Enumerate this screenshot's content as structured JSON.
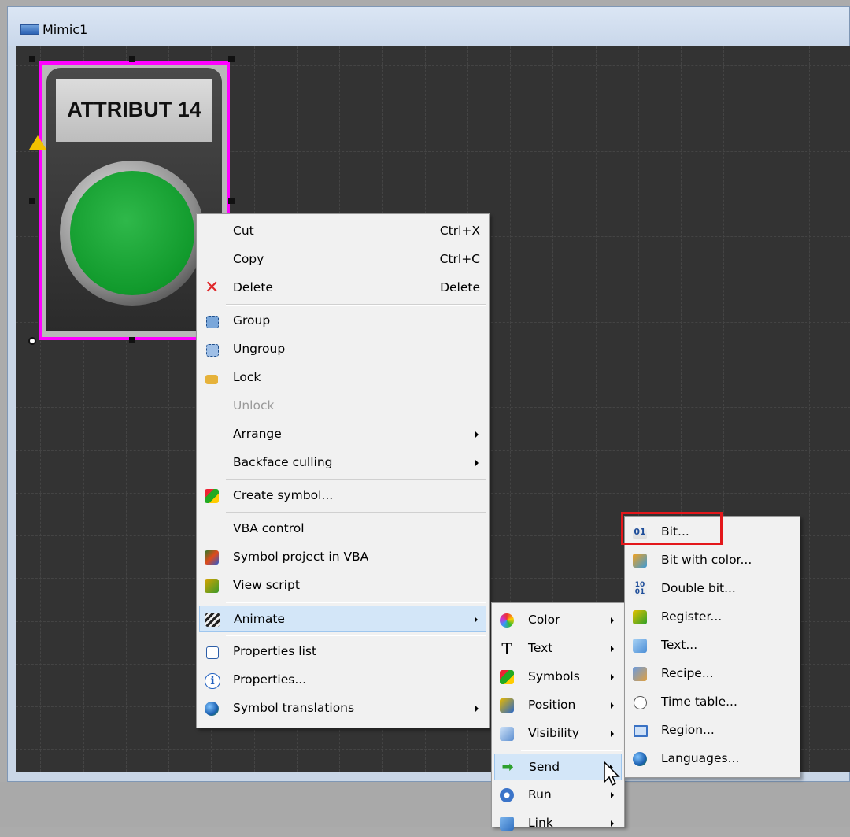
{
  "window": {
    "title": "Mimic1"
  },
  "symbol": {
    "label": "ATTRIBUT 14"
  },
  "context_menu": {
    "items": [
      {
        "label": "Cut",
        "shortcut": "Ctrl+X",
        "icon": "none"
      },
      {
        "label": "Copy",
        "shortcut": "Ctrl+C",
        "icon": "none"
      },
      {
        "label": "Delete",
        "shortcut": "Delete",
        "icon": "red-x-icon"
      },
      {
        "label": "Group",
        "icon": "group-icon"
      },
      {
        "label": "Ungroup",
        "icon": "ungroup-icon"
      },
      {
        "label": "Lock",
        "icon": "padlock-icon"
      },
      {
        "label": "Unlock",
        "disabled": true
      },
      {
        "label": "Arrange",
        "submenu": true
      },
      {
        "label": "Backface culling",
        "submenu": true
      },
      {
        "label": "Create symbol...",
        "icon": "create-symbol-icon"
      },
      {
        "label": "VBA control"
      },
      {
        "label": "Symbol project in VBA",
        "icon": "vba-project-icon"
      },
      {
        "label": "View script",
        "icon": "script-icon"
      },
      {
        "label": "Animate",
        "submenu": true,
        "highlighted": true,
        "icon": "clapperboard-icon"
      },
      {
        "label": "Properties list",
        "icon": "properties-list-icon"
      },
      {
        "label": "Properties...",
        "icon": "info-icon"
      },
      {
        "label": "Symbol translations",
        "submenu": true,
        "icon": "globe-icon"
      }
    ]
  },
  "animate_menu": {
    "items": [
      {
        "label": "Color",
        "icon": "color-wheel-icon"
      },
      {
        "label": "Text",
        "icon": "text-t-icon"
      },
      {
        "label": "Symbols",
        "icon": "symbols-icon"
      },
      {
        "label": "Position",
        "icon": "position-icon"
      },
      {
        "label": "Visibility",
        "icon": "visibility-icon"
      },
      {
        "label": "Send",
        "icon": "green-arrow-icon",
        "highlighted": true
      },
      {
        "label": "Run",
        "icon": "gear-icon"
      },
      {
        "label": "Link",
        "icon": "link-icon"
      }
    ]
  },
  "send_menu": {
    "items": [
      {
        "label": "Bit...",
        "icon": "bit-icon",
        "boxed": true
      },
      {
        "label": "Bit with color...",
        "icon": "bit-color-icon"
      },
      {
        "label": "Double bit...",
        "icon": "double-bit-icon"
      },
      {
        "label": "Register...",
        "icon": "register-icon"
      },
      {
        "label": "Text...",
        "icon": "text-send-icon"
      },
      {
        "label": "Recipe...",
        "icon": "recipe-icon"
      },
      {
        "label": "Time table...",
        "icon": "time-table-icon"
      },
      {
        "label": "Region...",
        "icon": "region-icon"
      },
      {
        "label": "Languages...",
        "icon": "languages-icon"
      }
    ]
  },
  "colors": {
    "selection": "#ff00ff",
    "highlight": "#d3e6f8",
    "callout": "#e3171b"
  }
}
